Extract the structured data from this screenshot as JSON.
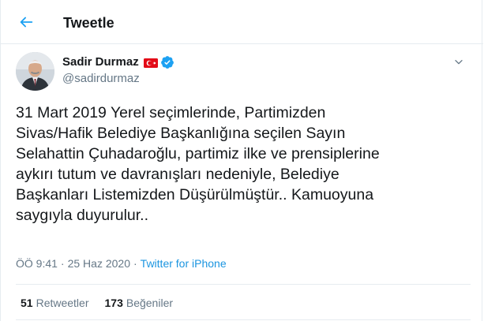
{
  "header": {
    "title": "Tweetle",
    "back_icon": "arrow-left-icon"
  },
  "author": {
    "name": "Sadir Durmaz",
    "handle": "@sadirdurmaz",
    "flag_icon": "turkey-flag-icon",
    "verified_icon": "verified-badge-icon"
  },
  "tweet": {
    "text": "31 Mart 2019 Yerel seçimlerinde,  Partimizden\nSivas/Hafik Belediye Başkanlığına seçilen Sayın\nSelahattin Çuhadaroğlu, partimiz ilke ve prensiplerine\naykırı tutum ve davranışları nedeniyle, Belediye\nBaşkanları Listemizden Düşürülmüştür.. Kamuoyuna\nsaygıyla duyurulur..",
    "time": "ÖÖ 9:41",
    "separator": "·",
    "date": "25 Haz 2020",
    "source": "Twitter for iPhone"
  },
  "stats": {
    "retweets_count": "51",
    "retweets_label": "Retweetler",
    "likes_count": "173",
    "likes_label": "Beğeniler"
  },
  "colors": {
    "accent": "#1da1f2",
    "link": "#1b95e0",
    "secondary_text": "#657786",
    "border": "#e6ecf0",
    "flag_red": "#e30a17"
  }
}
